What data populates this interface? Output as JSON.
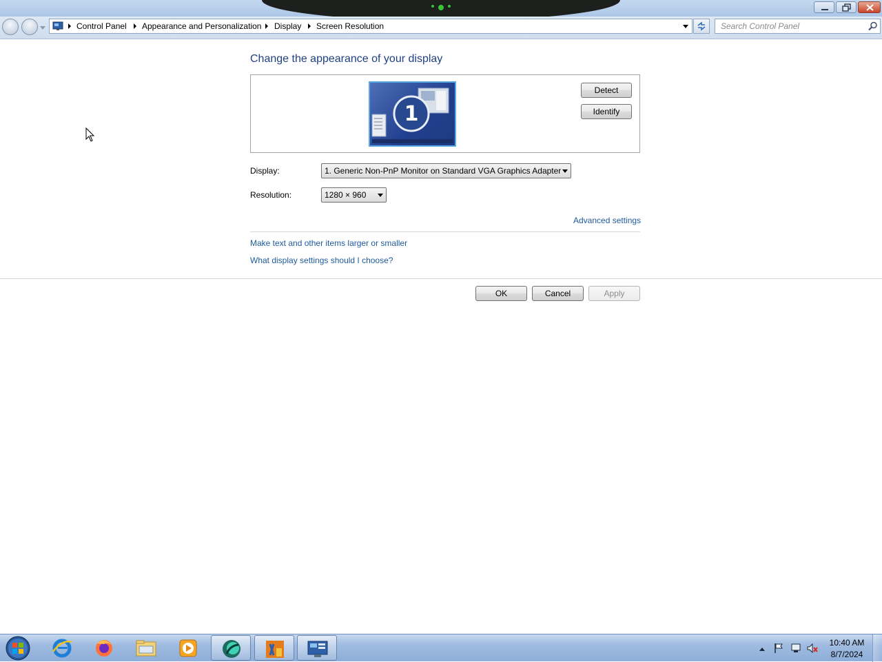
{
  "address_bar": {
    "breadcrumbs": [
      "Control Panel",
      "Appearance and Personalization",
      "Display",
      "Screen Resolution"
    ]
  },
  "search": {
    "placeholder": "Search Control Panel"
  },
  "main": {
    "heading": "Change the appearance of your display",
    "monitor_number": "1",
    "detect_label": "Detect",
    "identify_label": "Identify",
    "display_label": "Display:",
    "display_value": "1. Generic Non-PnP Monitor on Standard VGA Graphics Adapter",
    "resolution_label": "Resolution:",
    "resolution_value": "1280 × 960",
    "advanced_link": "Advanced settings",
    "links": [
      "Make text and other items larger or smaller",
      "What display settings should I choose?"
    ],
    "ok_label": "OK",
    "cancel_label": "Cancel",
    "apply_label": "Apply"
  },
  "taskbar": {
    "items": [
      {
        "icon": "internet-explorer-icon"
      },
      {
        "icon": "firefox-icon"
      },
      {
        "icon": "file-explorer-icon"
      },
      {
        "icon": "media-player-icon"
      },
      {
        "icon": "app-green-icon"
      },
      {
        "icon": "app-orange-icon"
      },
      {
        "icon": "control-panel-icon"
      }
    ],
    "clock_time": "10:40 AM",
    "clock_date": "8/7/2024"
  },
  "colors": {
    "heading": "#1e3f83",
    "link": "#1e5a9c",
    "taskbar": "#9fbbe0",
    "monitor_tile": "#203f8e"
  }
}
